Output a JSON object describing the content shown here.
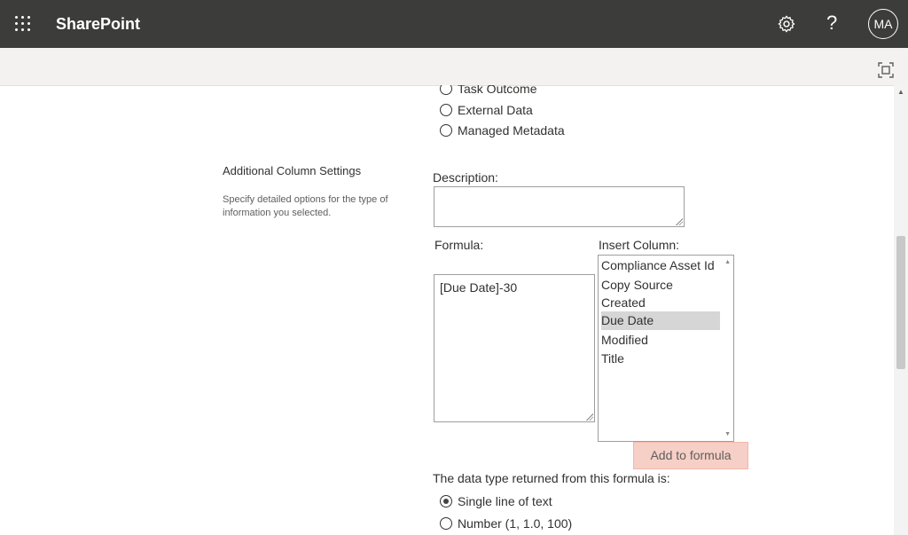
{
  "app": {
    "name": "SharePoint"
  },
  "header": {
    "avatar_initials": "MA",
    "help_glyph": "?"
  },
  "icons": {
    "waffle": "waffle-icon",
    "settings": "gear-icon",
    "help": "help-icon",
    "focus": "focus-mode-icon"
  },
  "column_types": [
    {
      "label": "Task Outcome",
      "selected": false
    },
    {
      "label": "External Data",
      "selected": false
    },
    {
      "label": "Managed Metadata",
      "selected": false
    }
  ],
  "additional_settings": {
    "title": "Additional Column Settings",
    "description": "Specify detailed options for the type of information you selected.",
    "description_label": "Description:",
    "description_value": "",
    "formula_label": "Formula:",
    "formula_value": "[Due Date]-30",
    "insert_column_label": "Insert Column:",
    "insert_columns": [
      "Compliance Asset Id",
      "Copy Source",
      "Created",
      "Due Date",
      "Modified",
      "Title"
    ],
    "selected_column": "Due Date",
    "add_to_formula_label": "Add to formula",
    "return_type_label": "The data type returned from this formula is:",
    "return_types": [
      {
        "label": "Single line of text",
        "selected": true
      },
      {
        "label": "Number (1, 1.0, 100)",
        "selected": false
      }
    ]
  },
  "colors": {
    "suite_bar": "#3c3c3b",
    "command_bar": "#f3f2f1",
    "add_button_bg": "#f6cfc7",
    "selected_item_bg": "#d6d6d6"
  }
}
